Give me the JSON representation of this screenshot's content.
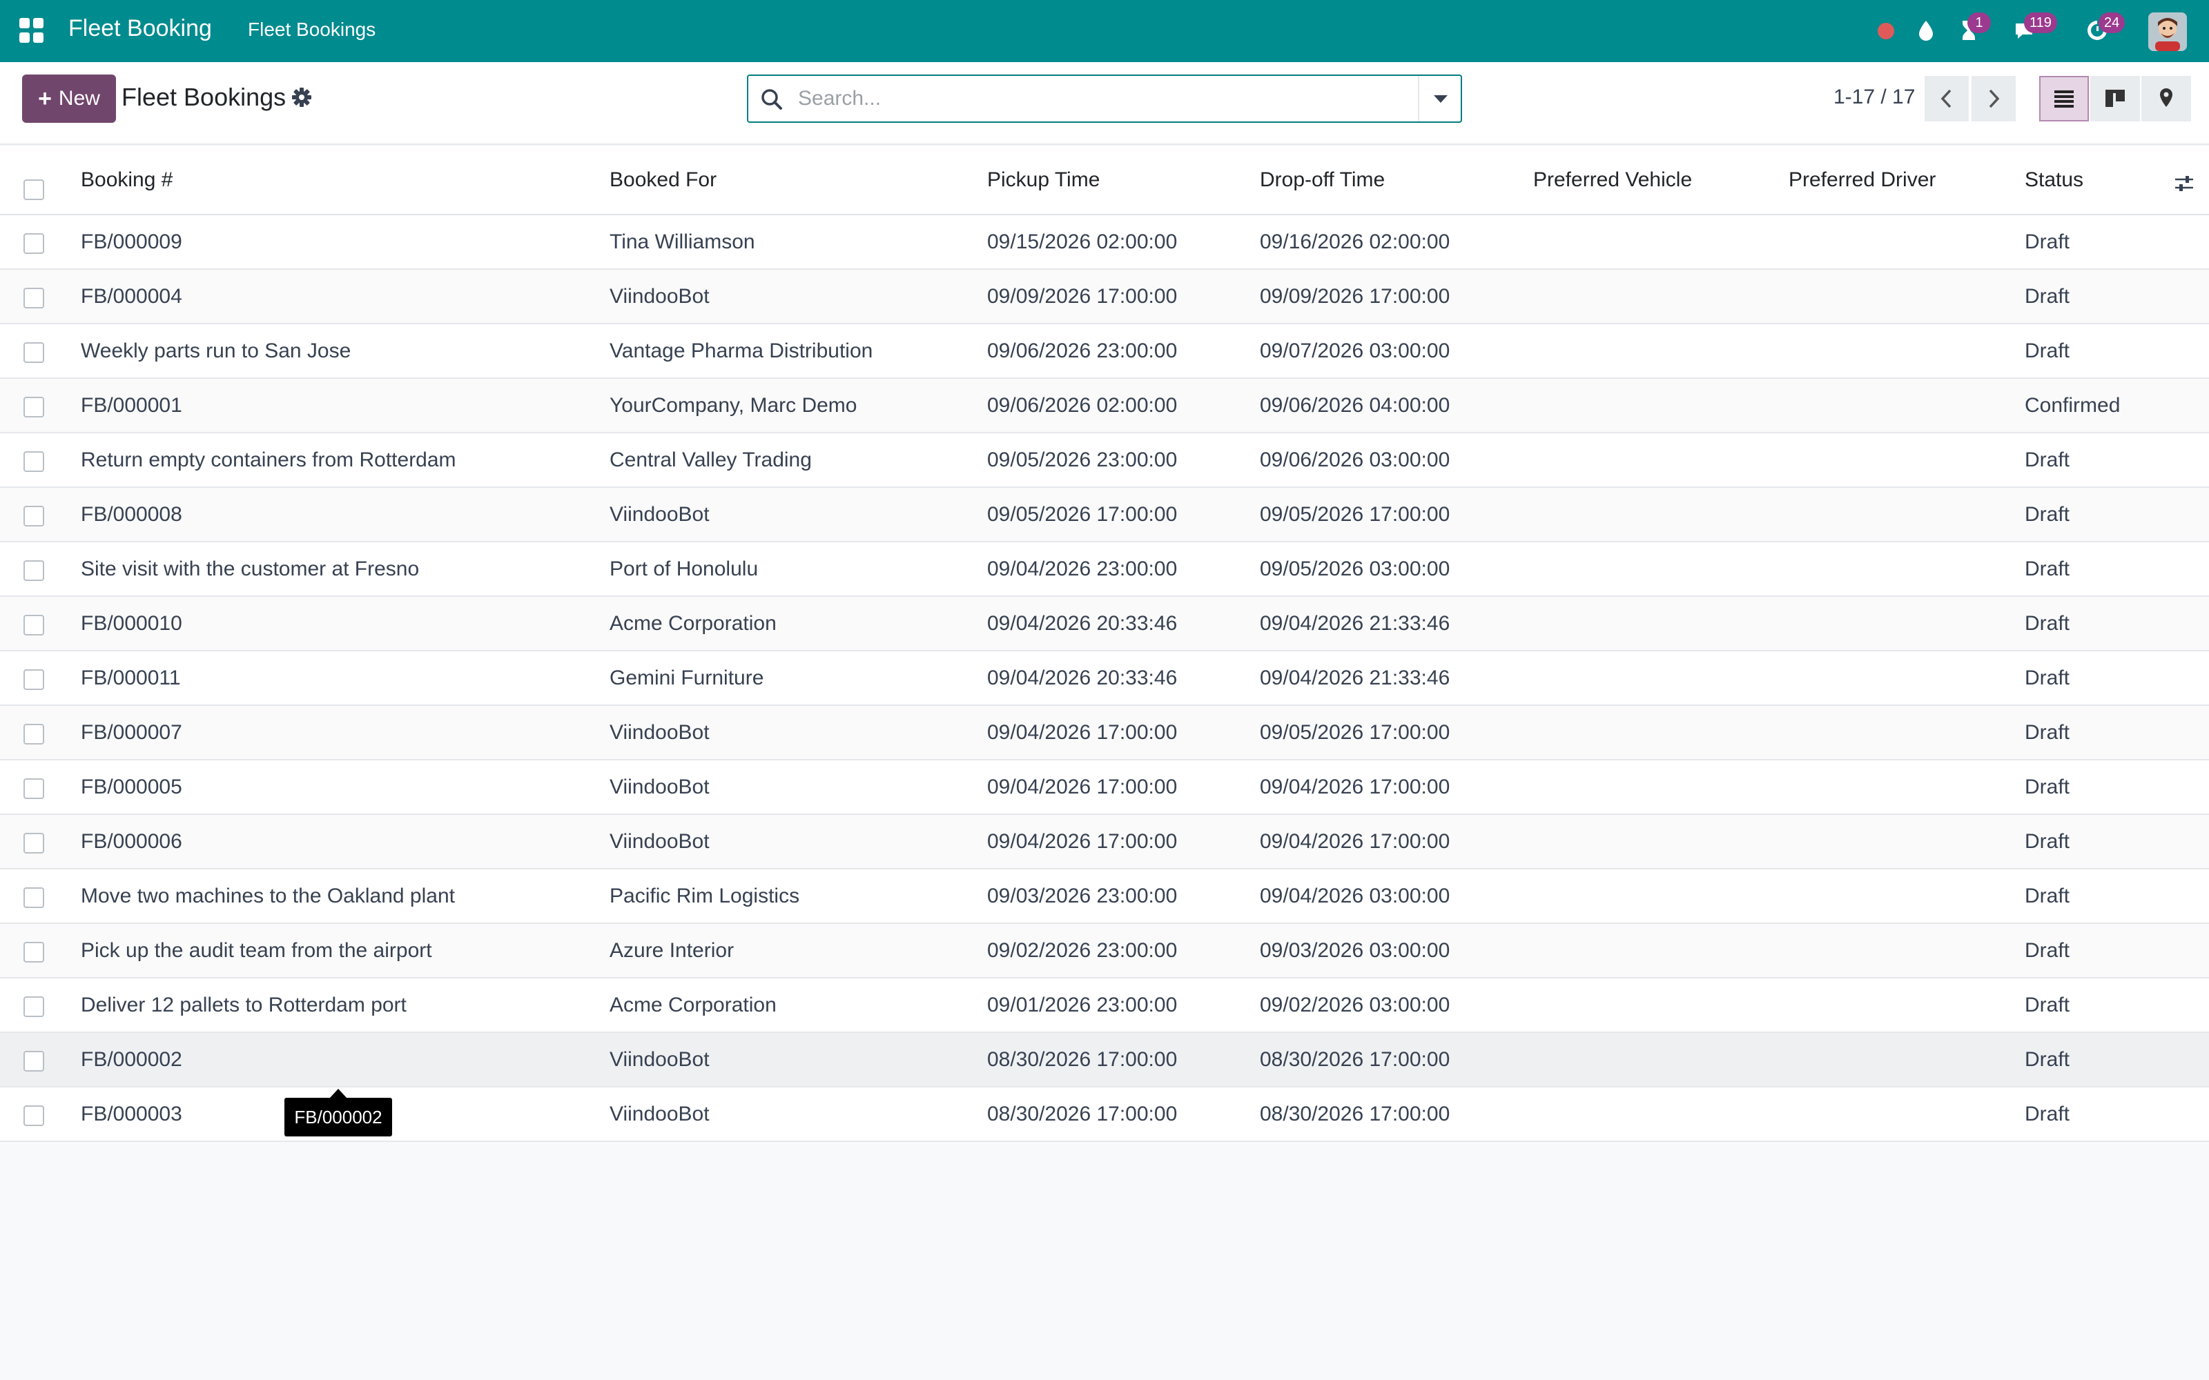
{
  "navbar": {
    "app_name": "Fleet Booking",
    "menu_item": "Fleet Bookings",
    "activities_badge": "1",
    "messages_badge": "119",
    "updates_badge": "24",
    "color": "#008b8f"
  },
  "controlbar": {
    "new_label": "New",
    "title": "Fleet Bookings",
    "search_placeholder": "Search...",
    "pager_value": "1-17 / 17",
    "accent_color": "#71466d"
  },
  "table": {
    "columns": [
      "Booking #",
      "Booked For",
      "Pickup Time",
      "Drop-off Time",
      "Preferred Vehicle",
      "Preferred Driver",
      "Status"
    ],
    "rows": [
      {
        "booking": "FB/000009",
        "booked_for": "Tina Williamson",
        "pickup": "09/15/2026 02:00:00",
        "dropoff": "09/16/2026 02:00:00",
        "vehicle": "",
        "driver": "",
        "status": "Draft"
      },
      {
        "booking": "FB/000004",
        "booked_for": "ViindooBot",
        "pickup": "09/09/2026 17:00:00",
        "dropoff": "09/09/2026 17:00:00",
        "vehicle": "",
        "driver": "",
        "status": "Draft"
      },
      {
        "booking": "Weekly parts run to San Jose",
        "booked_for": "Vantage Pharma Distribution",
        "pickup": "09/06/2026 23:00:00",
        "dropoff": "09/07/2026 03:00:00",
        "vehicle": "",
        "driver": "",
        "status": "Draft"
      },
      {
        "booking": "FB/000001",
        "booked_for": "YourCompany, Marc Demo",
        "pickup": "09/06/2026 02:00:00",
        "dropoff": "09/06/2026 04:00:00",
        "vehicle": "",
        "driver": "",
        "status": "Confirmed"
      },
      {
        "booking": "Return empty containers from Rotterdam",
        "booked_for": "Central Valley Trading",
        "pickup": "09/05/2026 23:00:00",
        "dropoff": "09/06/2026 03:00:00",
        "vehicle": "",
        "driver": "",
        "status": "Draft"
      },
      {
        "booking": "FB/000008",
        "booked_for": "ViindooBot",
        "pickup": "09/05/2026 17:00:00",
        "dropoff": "09/05/2026 17:00:00",
        "vehicle": "",
        "driver": "",
        "status": "Draft"
      },
      {
        "booking": "Site visit with the customer at Fresno",
        "booked_for": "Port of Honolulu",
        "pickup": "09/04/2026 23:00:00",
        "dropoff": "09/05/2026 03:00:00",
        "vehicle": "",
        "driver": "",
        "status": "Draft"
      },
      {
        "booking": "FB/000010",
        "booked_for": "Acme Corporation",
        "pickup": "09/04/2026 20:33:46",
        "dropoff": "09/04/2026 21:33:46",
        "vehicle": "",
        "driver": "",
        "status": "Draft"
      },
      {
        "booking": "FB/000011",
        "booked_for": "Gemini Furniture",
        "pickup": "09/04/2026 20:33:46",
        "dropoff": "09/04/2026 21:33:46",
        "vehicle": "",
        "driver": "",
        "status": "Draft"
      },
      {
        "booking": "FB/000007",
        "booked_for": "ViindooBot",
        "pickup": "09/04/2026 17:00:00",
        "dropoff": "09/05/2026 17:00:00",
        "vehicle": "",
        "driver": "",
        "status": "Draft"
      },
      {
        "booking": "FB/000005",
        "booked_for": "ViindooBot",
        "pickup": "09/04/2026 17:00:00",
        "dropoff": "09/04/2026 17:00:00",
        "vehicle": "",
        "driver": "",
        "status": "Draft"
      },
      {
        "booking": "FB/000006",
        "booked_for": "ViindooBot",
        "pickup": "09/04/2026 17:00:00",
        "dropoff": "09/04/2026 17:00:00",
        "vehicle": "",
        "driver": "",
        "status": "Draft"
      },
      {
        "booking": "Move two machines to the Oakland plant",
        "booked_for": "Pacific Rim Logistics",
        "pickup": "09/03/2026 23:00:00",
        "dropoff": "09/04/2026 03:00:00",
        "vehicle": "",
        "driver": "",
        "status": "Draft"
      },
      {
        "booking": "Pick up the audit team from the airport",
        "booked_for": "Azure Interior",
        "pickup": "09/02/2026 23:00:00",
        "dropoff": "09/03/2026 03:00:00",
        "vehicle": "",
        "driver": "",
        "status": "Draft"
      },
      {
        "booking": "Deliver 12 pallets to Rotterdam port",
        "booked_for": "Acme Corporation",
        "pickup": "09/01/2026 23:00:00",
        "dropoff": "09/02/2026 03:00:00",
        "vehicle": "",
        "driver": "",
        "status": "Draft"
      },
      {
        "booking": "FB/000002",
        "booked_for": "ViindooBot",
        "pickup": "08/30/2026 17:00:00",
        "dropoff": "08/30/2026 17:00:00",
        "vehicle": "",
        "driver": "",
        "status": "Draft"
      },
      {
        "booking": "FB/000003",
        "booked_for": "ViindooBot",
        "pickup": "08/30/2026 17:00:00",
        "dropoff": "08/30/2026 17:00:00",
        "vehicle": "",
        "driver": "",
        "status": "Draft"
      }
    ]
  },
  "tooltip": {
    "text": "FB/000002"
  },
  "icons": [
    "apps-grid-icon",
    "record-dot-icon",
    "droplet-icon",
    "hourglass-icon",
    "chat-icon",
    "refresh-clock-icon",
    "avatar",
    "plus-icon",
    "gear-icon",
    "search-icon",
    "caret-down-icon",
    "chevron-left-icon",
    "chevron-right-icon",
    "list-view-icon",
    "kanban-view-icon",
    "map-pin-icon",
    "optional-columns-icon"
  ]
}
